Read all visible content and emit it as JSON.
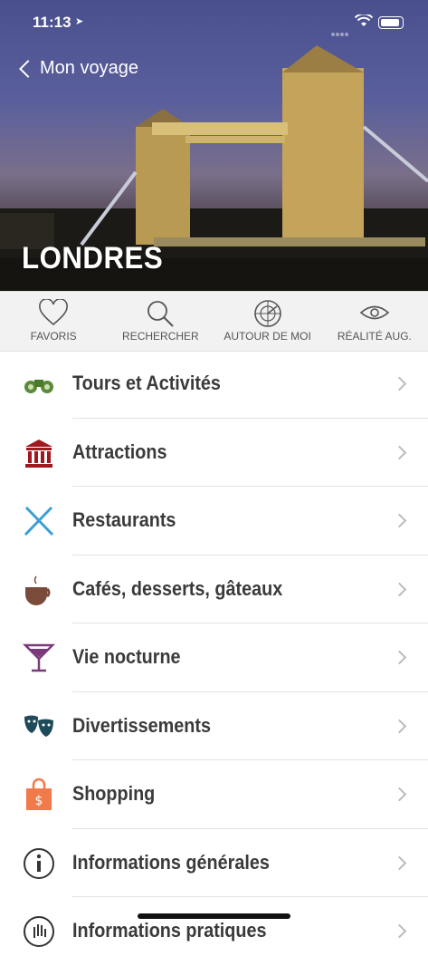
{
  "status": {
    "time": "11:13"
  },
  "header": {
    "back_label": "Mon voyage",
    "city": "LONDRES"
  },
  "toolbar": [
    {
      "label": "FAVORIS",
      "icon": "heart-icon"
    },
    {
      "label": "RECHERCHER",
      "icon": "search-icon"
    },
    {
      "label": "AUTOUR DE MOI",
      "icon": "radar-icon"
    },
    {
      "label": "RÉALITÉ AUG.",
      "icon": "eye-icon"
    }
  ],
  "menu": [
    {
      "label": "Tours et Activités",
      "icon": "binoculars-icon",
      "color": "#5a8a3a"
    },
    {
      "label": "Attractions",
      "icon": "museum-icon",
      "color": "#a0181e"
    },
    {
      "label": "Restaurants",
      "icon": "cutlery-icon",
      "color": "#3b9fd6"
    },
    {
      "label": "Cafés, desserts, gâteaux",
      "icon": "coffee-cup-icon",
      "color": "#7a4a3a"
    },
    {
      "label": "Vie nocturne",
      "icon": "cocktail-glass-icon",
      "color": "#7a3a7a"
    },
    {
      "label": "Divertissements",
      "icon": "theater-masks-icon",
      "color": "#1f4a5a"
    },
    {
      "label": "Shopping",
      "icon": "shopping-bag-icon",
      "color": "#f07a4a"
    },
    {
      "label": "Informations générales",
      "icon": "info-icon",
      "color": "#333333"
    },
    {
      "label": "Informations pratiques",
      "icon": "hand-icon",
      "color": "#333333"
    }
  ]
}
